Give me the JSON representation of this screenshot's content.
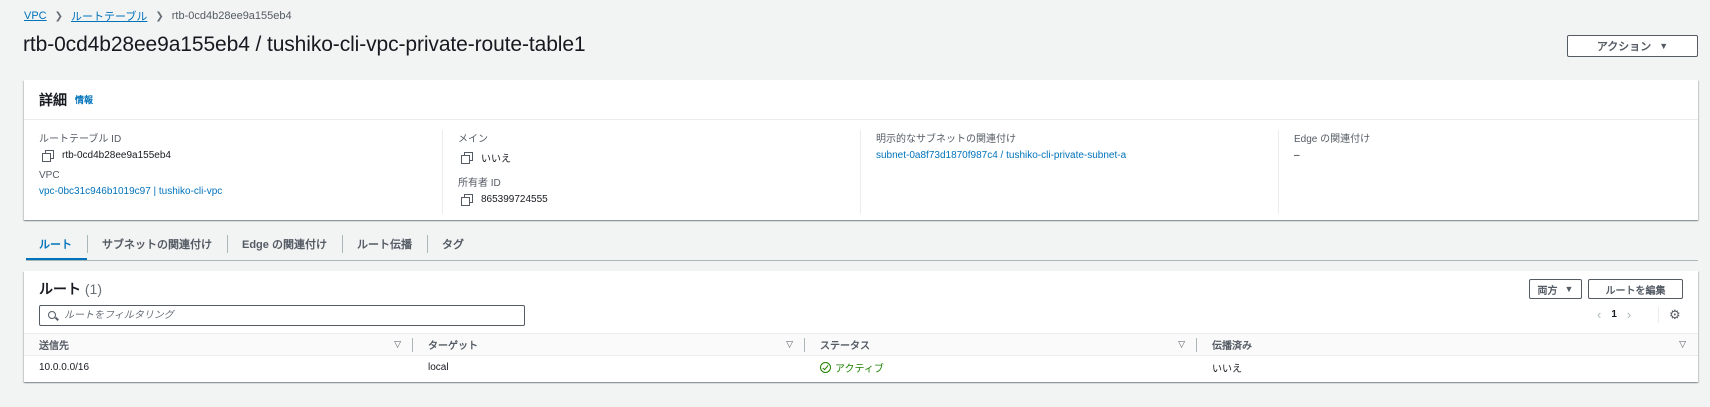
{
  "breadcrumb": {
    "items": [
      "VPC",
      "ルートテーブル"
    ],
    "current": "rtb-0cd4b28ee9a155eb4"
  },
  "header": {
    "title": "rtb-0cd4b28ee9a155eb4 / tushiko-cli-vpc-private-route-table1",
    "action_label": "アクション"
  },
  "details": {
    "title": "詳細",
    "info_link": "情報",
    "route_table_id_label": "ルートテーブル ID",
    "route_table_id": "rtb-0cd4b28ee9a155eb4",
    "vpc_label": "VPC",
    "vpc_value": "vpc-0bc31c946b1019c97 | tushiko-cli-vpc",
    "main_label": "メイン",
    "main_value": "いいえ",
    "owner_label": "所有者 ID",
    "owner_value": "865399724555",
    "subnet_assoc_label": "明示的なサブネットの関連付け",
    "subnet_assoc_value": "subnet-0a8f73d1870f987c4 / tushiko-cli-private-subnet-a",
    "edge_assoc_label": "Edge の関連付け",
    "edge_assoc_value": "–"
  },
  "tabs": [
    "ルート",
    "サブネットの関連付け",
    "Edge の関連付け",
    "ルート伝播",
    "タグ"
  ],
  "routes": {
    "title": "ルート",
    "count": "(1)",
    "both_label": "両方",
    "edit_label": "ルートを編集",
    "filter_placeholder": "ルートをフィルタリング",
    "page": "1",
    "columns": [
      "送信先",
      "ターゲット",
      "ステータス",
      "伝播済み"
    ],
    "rows": [
      {
        "destination": "10.0.0.0/16",
        "target": "local",
        "status": "アクティブ",
        "propagated": "いいえ"
      }
    ]
  },
  "colors": {
    "link": "#0073bb",
    "status_active": "#1d8102",
    "background": "#f2f3f3"
  },
  "icons": [
    "copy-icon",
    "search-icon",
    "gear-icon",
    "chevron-left-icon",
    "chevron-right-icon",
    "sort-icon",
    "status-ok-icon",
    "caret-down-icon"
  ]
}
